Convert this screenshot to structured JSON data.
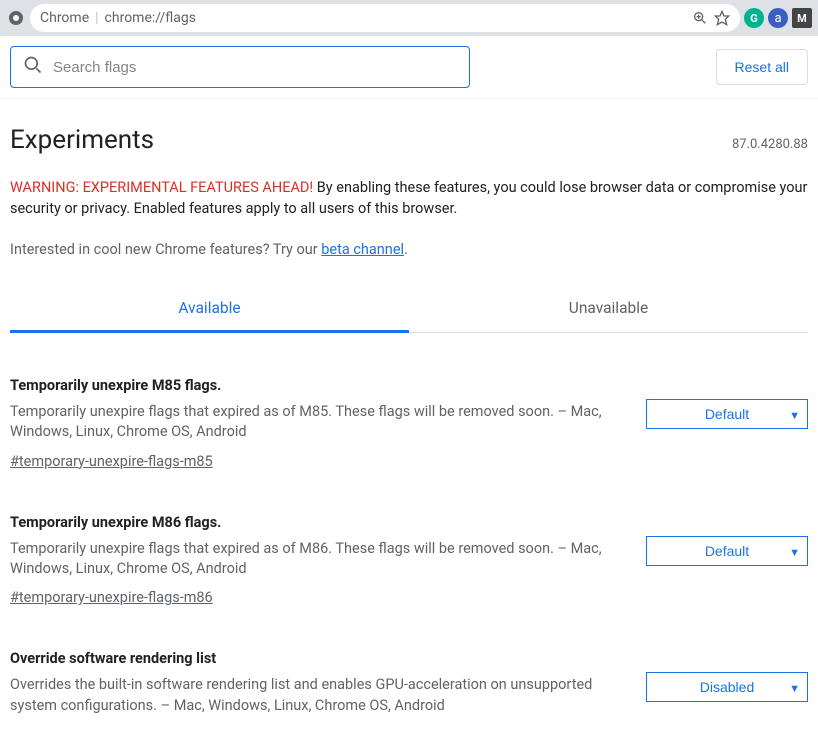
{
  "chrome": {
    "label": "Chrome",
    "url": "chrome://flags"
  },
  "topbar": {
    "search_placeholder": "Search flags",
    "reset_label": "Reset all"
  },
  "header": {
    "title": "Experiments",
    "version": "87.0.4280.88"
  },
  "warning": {
    "headline": "WARNING: EXPERIMENTAL FEATURES AHEAD!",
    "body": " By enabling these features, you could lose browser data or compromise your security or privacy. Enabled features apply to all users of this browser."
  },
  "interest": {
    "text": "Interested in cool new Chrome features? Try our ",
    "link_label": "beta channel",
    "period": "."
  },
  "tabs": {
    "available": "Available",
    "unavailable": "Unavailable"
  },
  "flags": [
    {
      "title": "Temporarily unexpire M85 flags.",
      "desc": "Temporarily unexpire flags that expired as of M85. These flags will be removed soon. – Mac, Windows, Linux, Chrome OS, Android",
      "anchor": "#temporary-unexpire-flags-m85",
      "select": "Default"
    },
    {
      "title": "Temporarily unexpire M86 flags.",
      "desc": "Temporarily unexpire flags that expired as of M86. These flags will be removed soon. – Mac, Windows, Linux, Chrome OS, Android",
      "anchor": "#temporary-unexpire-flags-m86",
      "select": "Default"
    },
    {
      "title": "Override software rendering list",
      "desc": "Overrides the built-in software rendering list and enables GPU-acceleration on unsupported system configurations. – Mac, Windows, Linux, Chrome OS, Android",
      "anchor": "",
      "select": "Disabled"
    }
  ]
}
